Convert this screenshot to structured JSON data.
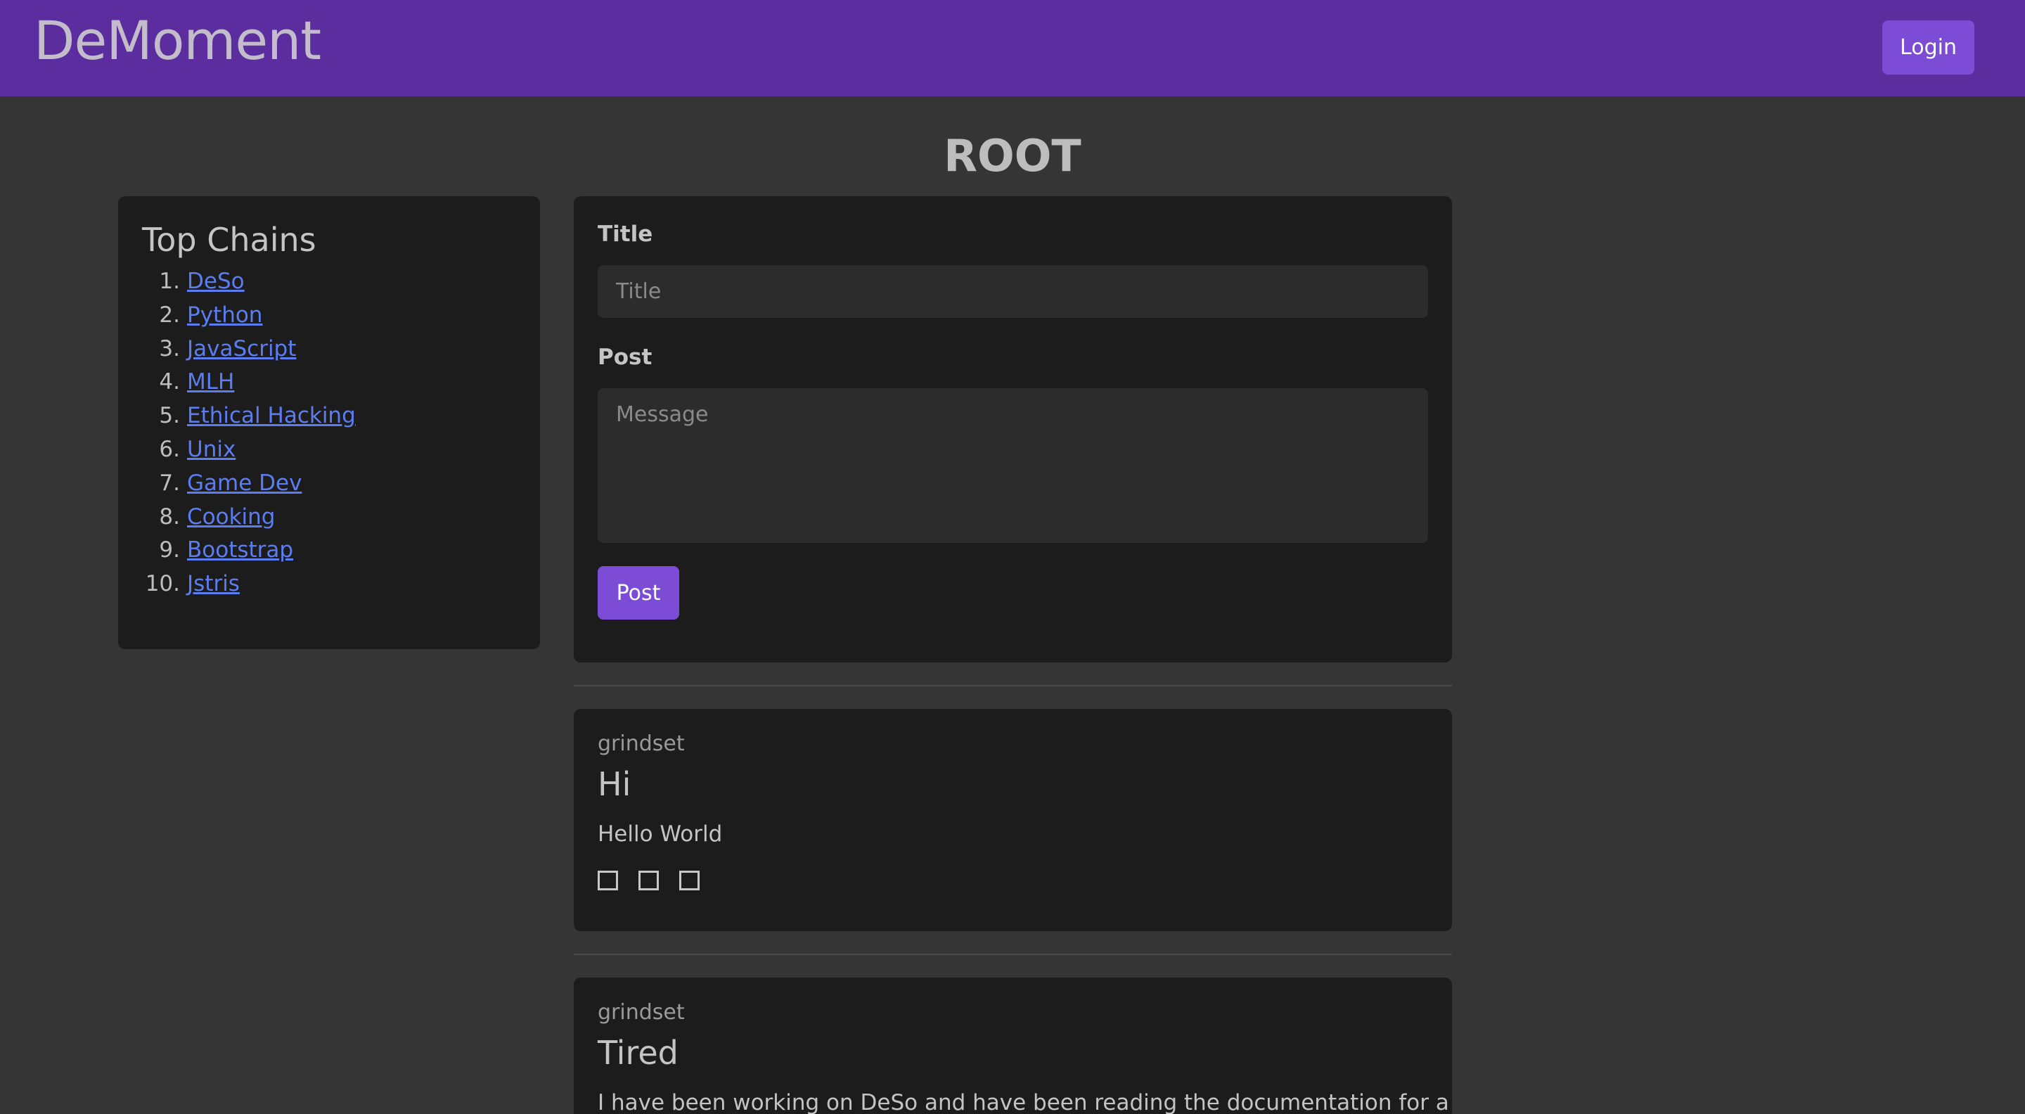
{
  "navbar": {
    "brand": "DeMoment",
    "login_label": "Login"
  },
  "page_title": "ROOT",
  "sidebar": {
    "heading": "Top Chains",
    "items": [
      {
        "num": "1.",
        "label": "DeSo"
      },
      {
        "num": "2.",
        "label": "Python"
      },
      {
        "num": "3.",
        "label": "JavaScript"
      },
      {
        "num": "4.",
        "label": "MLH"
      },
      {
        "num": "5.",
        "label": "Ethical Hacking"
      },
      {
        "num": "6.",
        "label": "Unix"
      },
      {
        "num": "7.",
        "label": "Game Dev"
      },
      {
        "num": "8.",
        "label": "Cooking"
      },
      {
        "num": "9.",
        "label": "Bootstrap"
      },
      {
        "num": "10.",
        "label": "Jstris"
      }
    ]
  },
  "composer": {
    "title_label": "Title",
    "title_placeholder": "Title",
    "post_label": "Post",
    "message_placeholder": "Message",
    "submit_label": "Post"
  },
  "posts": [
    {
      "user": "grindset",
      "title": "Hi",
      "body": "Hello World"
    },
    {
      "user": "grindset",
      "title": "Tired",
      "body": "I have been working on DeSo and have been reading the documentation for a long"
    }
  ],
  "colors": {
    "navbar": "#5b2d9e",
    "accent": "#7c4cd6",
    "link": "#5c7df0",
    "background": "#353535",
    "card": "#1c1c1c"
  }
}
